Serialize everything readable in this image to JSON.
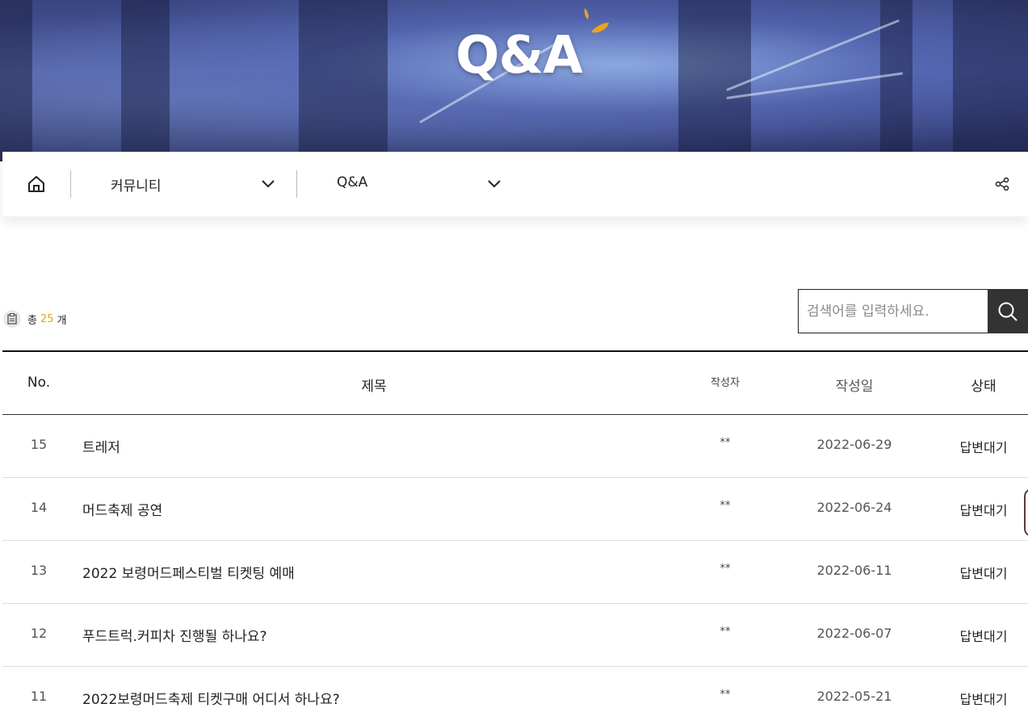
{
  "hero": {
    "title": "Q&A"
  },
  "navbar": {
    "menu1": "커뮤니티",
    "menu2": "Q&A"
  },
  "count": {
    "prefix": "총",
    "value": "25",
    "suffix": "개"
  },
  "search": {
    "placeholder": "검색어를 입력하세요."
  },
  "table": {
    "headers": {
      "no": "No.",
      "title": "제목",
      "author": "작성자",
      "date": "작성일",
      "status": "상태"
    },
    "rows": [
      {
        "no": "15",
        "title": "트레저",
        "author": "**",
        "date": "2022-06-29",
        "status": "답변대기"
      },
      {
        "no": "14",
        "title": "머드축제 공연",
        "author": "**",
        "date": "2022-06-24",
        "status": "답변대기"
      },
      {
        "no": "13",
        "title": "2022 보령머드페스티벌 티켓팅 예매",
        "author": "**",
        "date": "2022-06-11",
        "status": "답변대기"
      },
      {
        "no": "12",
        "title": "푸드트럭.커피차 진행될 하나요?",
        "author": "**",
        "date": "2022-06-07",
        "status": "답변대기"
      },
      {
        "no": "11",
        "title": "2022보령머드축제 티켓구매 어디서 하나요?",
        "author": "**",
        "date": "2022-05-21",
        "status": "답변대기"
      }
    ]
  },
  "colors": {
    "accent": "#e8a318",
    "drop": "#f0a21a",
    "search_button": "#333333"
  }
}
